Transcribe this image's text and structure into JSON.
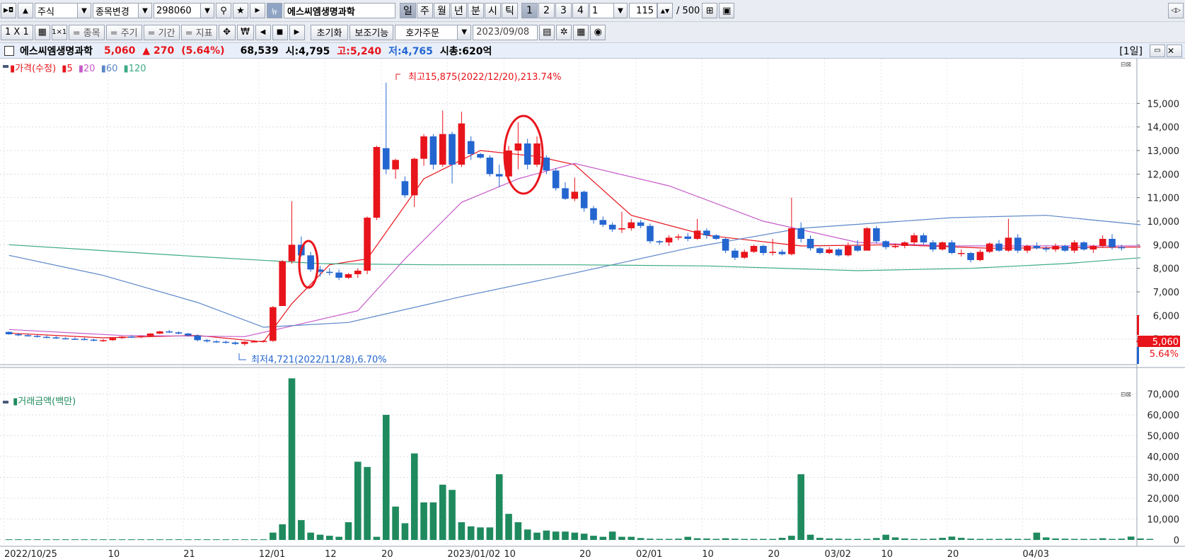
{
  "toolbar": {
    "market": "주식",
    "change_stock": "종목변경",
    "code": "298060",
    "name": "에스씨엠생명과학",
    "periods": [
      "일",
      "주",
      "월",
      "년",
      "분",
      "시",
      "틱"
    ],
    "numbers": [
      "1",
      "2",
      "3",
      "4"
    ],
    "period_value": "1",
    "count": "115",
    "total": "/ 500",
    "layout": "1 X 1",
    "tools": [
      "= 종목",
      "= 주기",
      "= 기간",
      "= 지표"
    ],
    "won": "₩",
    "reset": "초기화",
    "aux": "보조기능",
    "order": "호가주문",
    "date": "2023/09/08"
  },
  "info": {
    "name": "에스씨엠생명과학",
    "price": "5,060",
    "change": "▲ 270",
    "rate": "(5.64%)",
    "volume": "68,539",
    "open": "시:4,795",
    "high": "고:5,240",
    "low": "저:4,765",
    "mcap": "시총:620억",
    "period_tag": "[1일]"
  },
  "legend": {
    "price": "가격(수정)",
    "ma": [
      "5",
      "20",
      "60",
      "120"
    ],
    "volume": "거래금액(백만)"
  },
  "annotations": {
    "high": "최고15,875(2022/12/20),213.74%",
    "low": "최저4,721(2022/11/28),6.70%"
  },
  "price_tag": "5,060",
  "rate_tag": "5.64%",
  "colors": {
    "up": "#e8141b",
    "down": "#2466d0",
    "volume": "#1f8a5e",
    "ma5": "#e8141b",
    "ma20": "#c65ac9",
    "ma60": "#5b86c8",
    "ma120": "#3dab85"
  },
  "chart_data": [
    {
      "type": "candlestick",
      "title": "",
      "ylim": [
        4000,
        16000
      ],
      "y_ticks": [
        "15,000",
        "14,000",
        "13,000",
        "12,000",
        "11,000",
        "10,000",
        "9,000",
        "8,000",
        "7,000",
        "6,000",
        "5,000"
      ],
      "x_tick_labels": [
        "2022/10/25",
        "10",
        "21",
        "12/01",
        "12",
        "20",
        "2023/01/02",
        "10",
        "20",
        "02/01",
        "10",
        "20",
        "03/02",
        "10",
        "20",
        "04/03"
      ],
      "candles": [
        [
          5300,
          5320,
          5180,
          5200
        ],
        [
          5200,
          5260,
          5120,
          5160
        ],
        [
          5160,
          5220,
          5100,
          5130
        ],
        [
          5130,
          5180,
          5060,
          5090
        ],
        [
          5090,
          5150,
          5040,
          5070
        ],
        [
          5070,
          5120,
          5000,
          5030
        ],
        [
          5030,
          5080,
          4980,
          5010
        ],
        [
          5010,
          5070,
          4960,
          5000
        ],
        [
          5000,
          5060,
          4940,
          4970
        ],
        [
          4970,
          5020,
          4900,
          4930
        ],
        [
          4930,
          4990,
          4880,
          4950
        ],
        [
          4950,
          5050,
          4920,
          5040
        ],
        [
          5040,
          5120,
          5000,
          5100
        ],
        [
          5100,
          5160,
          5060,
          5080
        ],
        [
          5080,
          5150,
          5040,
          5120
        ],
        [
          5120,
          5250,
          5100,
          5230
        ],
        [
          5230,
          5350,
          5200,
          5320
        ],
        [
          5320,
          5380,
          5250,
          5280
        ],
        [
          5280,
          5320,
          5200,
          5230
        ],
        [
          5230,
          5260,
          5100,
          5150
        ],
        [
          5150,
          5200,
          4900,
          4950
        ],
        [
          4950,
          5000,
          4850,
          4900
        ],
        [
          4900,
          4950,
          4830,
          4880
        ],
        [
          4880,
          4930,
          4800,
          4850
        ],
        [
          4850,
          4900,
          4750,
          4790
        ],
        [
          4790,
          4900,
          4721,
          4880
        ],
        [
          4880,
          4950,
          4850,
          4900
        ],
        [
          4900,
          4950,
          4860,
          4920
        ],
        [
          4920,
          6400,
          4880,
          6350
        ],
        [
          6400,
          8350,
          7000,
          8300
        ],
        [
          8300,
          10850,
          8200,
          9000
        ],
        [
          9000,
          9350,
          8500,
          8550
        ],
        [
          8550,
          8700,
          7850,
          7950
        ],
        [
          7950,
          8100,
          7650,
          7850
        ],
        [
          7850,
          8000,
          7700,
          7820
        ],
        [
          7820,
          7950,
          7500,
          7600
        ],
        [
          7600,
          7800,
          7550,
          7750
        ],
        [
          7750,
          8000,
          7600,
          7900
        ],
        [
          7900,
          10200,
          7750,
          10150
        ],
        [
          10150,
          13200,
          10050,
          13150
        ],
        [
          13100,
          15875,
          12000,
          12200
        ],
        [
          12200,
          12650,
          11800,
          12600
        ],
        [
          11700,
          11900,
          11000,
          11100
        ],
        [
          11100,
          12700,
          10600,
          12650
        ],
        [
          12650,
          13700,
          12350,
          13600
        ],
        [
          13600,
          13700,
          12200,
          12400
        ],
        [
          12400,
          14700,
          12300,
          13700
        ],
        [
          13700,
          13800,
          11600,
          12400
        ],
        [
          12400,
          14650,
          12300,
          14150
        ],
        [
          13400,
          13600,
          12600,
          12850
        ],
        [
          12850,
          12900,
          12650,
          12700
        ],
        [
          12700,
          12800,
          11900,
          12000
        ],
        [
          12000,
          12400,
          11450,
          11900
        ],
        [
          11900,
          13200,
          11800,
          13000
        ],
        [
          13000,
          14200,
          12200,
          13300
        ],
        [
          13300,
          13500,
          12200,
          12400
        ],
        [
          12400,
          13600,
          12300,
          13300
        ],
        [
          12700,
          12800,
          12000,
          12150
        ],
        [
          12150,
          12250,
          11300,
          11400
        ],
        [
          11400,
          11650,
          10900,
          10950
        ],
        [
          10950,
          11850,
          10850,
          11250
        ],
        [
          11250,
          11300,
          10400,
          10550
        ],
        [
          10550,
          10650,
          9900,
          10050
        ],
        [
          10050,
          10200,
          9750,
          9850
        ],
        [
          9850,
          9950,
          9550,
          9650
        ],
        [
          9650,
          10400,
          9500,
          9700
        ],
        [
          9700,
          10100,
          9600,
          9950
        ],
        [
          9950,
          10050,
          9700,
          9800
        ],
        [
          9800,
          9900,
          9050,
          9150
        ],
        [
          9150,
          9200,
          9000,
          9100
        ],
        [
          9100,
          9400,
          8950,
          9300
        ],
        [
          9300,
          9450,
          9200,
          9350
        ],
        [
          9350,
          9500,
          9150,
          9250
        ],
        [
          9250,
          10100,
          9200,
          9600
        ],
        [
          9600,
          9700,
          9250,
          9400
        ],
        [
          9400,
          9450,
          9200,
          9250
        ],
        [
          9250,
          9300,
          8650,
          8750
        ],
        [
          8750,
          8850,
          8350,
          8450
        ],
        [
          8450,
          8800,
          8400,
          8700
        ],
        [
          8700,
          9000,
          8650,
          8950
        ],
        [
          8950,
          9000,
          8550,
          8650
        ],
        [
          8650,
          9250,
          8550,
          8700
        ],
        [
          8700,
          8800,
          8550,
          8600
        ],
        [
          8600,
          11000,
          8550,
          9700
        ],
        [
          9700,
          9950,
          9100,
          9250
        ],
        [
          9250,
          9400,
          8750,
          8850
        ],
        [
          8850,
          8900,
          8600,
          8650
        ],
        [
          8650,
          8900,
          8600,
          8800
        ],
        [
          8800,
          8850,
          8500,
          8550
        ],
        [
          8550,
          9100,
          8500,
          8950
        ],
        [
          8950,
          9200,
          8700,
          8750
        ],
        [
          8750,
          9750,
          8900,
          9700
        ],
        [
          9700,
          9800,
          9050,
          9150
        ],
        [
          9150,
          9200,
          8800,
          8900
        ],
        [
          8900,
          9050,
          8850,
          8950
        ],
        [
          8950,
          9150,
          8850,
          9100
        ],
        [
          9100,
          9500,
          8950,
          9400
        ],
        [
          9400,
          9500,
          9000,
          9100
        ],
        [
          9100,
          9200,
          8700,
          8800
        ],
        [
          8800,
          9150,
          8750,
          9100
        ],
        [
          9100,
          9200,
          8600,
          8650
        ],
        [
          8650,
          8800,
          8500,
          8650
        ],
        [
          8650,
          8700,
          8250,
          8350
        ],
        [
          8350,
          8800,
          8300,
          8700
        ],
        [
          8700,
          9100,
          8650,
          9050
        ],
        [
          9050,
          9200,
          8700,
          8750
        ],
        [
          8750,
          10100,
          8700,
          9300
        ],
        [
          9300,
          9450,
          8650,
          8750
        ],
        [
          8750,
          9000,
          8650,
          8950
        ],
        [
          8950,
          9100,
          8800,
          8850
        ],
        [
          8850,
          8950,
          8700,
          8800
        ],
        [
          8800,
          9050,
          8700,
          8950
        ],
        [
          8950,
          9000,
          8700,
          8750
        ],
        [
          8750,
          9200,
          8650,
          9100
        ],
        [
          9100,
          9150,
          8750,
          8800
        ],
        [
          8800,
          9000,
          8650,
          8950
        ],
        [
          8950,
          9400,
          8900,
          9250
        ],
        [
          9250,
          9450,
          8800,
          8900
        ],
        [
          8900,
          9000,
          8750,
          8850
        ]
      ],
      "ma": {
        "5": [
          [
            0,
            5250
          ],
          [
            10,
            5050
          ],
          [
            20,
            5150
          ],
          [
            27,
            4880
          ],
          [
            30,
            6500
          ],
          [
            34,
            8150
          ],
          [
            38,
            8400
          ],
          [
            44,
            11800
          ],
          [
            50,
            13000
          ],
          [
            56,
            12750
          ],
          [
            60,
            12400
          ],
          [
            66,
            10250
          ],
          [
            74,
            9400
          ],
          [
            84,
            8950
          ],
          [
            94,
            9000
          ],
          [
            104,
            8850
          ],
          [
            120,
            8900
          ]
        ],
        "20": [
          [
            0,
            5400
          ],
          [
            12,
            5150
          ],
          [
            25,
            5100
          ],
          [
            30,
            5550
          ],
          [
            37,
            6200
          ],
          [
            42,
            8400
          ],
          [
            48,
            10800
          ],
          [
            54,
            11800
          ],
          [
            60,
            12450
          ],
          [
            70,
            11500
          ],
          [
            80,
            10000
          ],
          [
            90,
            9100
          ],
          [
            100,
            8950
          ],
          [
            110,
            8950
          ],
          [
            120,
            8950
          ]
        ],
        "60": [
          [
            0,
            8550
          ],
          [
            10,
            7700
          ],
          [
            20,
            6550
          ],
          [
            27,
            5500
          ],
          [
            36,
            5700
          ],
          [
            48,
            6800
          ],
          [
            60,
            7800
          ],
          [
            72,
            8850
          ],
          [
            84,
            9700
          ],
          [
            100,
            10150
          ],
          [
            110,
            10250
          ],
          [
            120,
            9850
          ]
        ],
        "120": [
          [
            0,
            9000
          ],
          [
            20,
            8500
          ],
          [
            33,
            8200
          ],
          [
            45,
            8150
          ],
          [
            60,
            8150
          ],
          [
            74,
            8100
          ],
          [
            90,
            7900
          ],
          [
            102,
            8000
          ],
          [
            112,
            8200
          ],
          [
            120,
            8450
          ]
        ]
      }
    },
    {
      "type": "bar",
      "title": "거래금액(백만)",
      "ylim": [
        0,
        80000
      ],
      "y_ticks": [
        "70,000",
        "60,000",
        "50,000",
        "40,000",
        "30,000",
        "20,000",
        "10,000",
        "0"
      ],
      "values": [
        300,
        300,
        300,
        300,
        300,
        300,
        300,
        300,
        300,
        300,
        300,
        300,
        300,
        300,
        300,
        300,
        300,
        300,
        300,
        300,
        300,
        300,
        300,
        300,
        300,
        300,
        300,
        300,
        3500,
        7500,
        77500,
        9500,
        3500,
        2500,
        2000,
        1500,
        8500,
        37500,
        35000,
        1500,
        60000,
        16000,
        8000,
        41500,
        18000,
        18000,
        26500,
        24000,
        8500,
        6500,
        6000,
        6000,
        31500,
        12500,
        8500,
        5000,
        3500,
        4500,
        4000,
        4000,
        3500,
        3000,
        2000,
        1500,
        4000,
        1500,
        1500,
        900,
        600,
        500,
        500,
        600,
        1500,
        800,
        700,
        500,
        800,
        600,
        500,
        500,
        500,
        500,
        1000,
        2000,
        31500,
        2500,
        1000,
        700,
        600,
        500,
        500,
        500,
        900,
        2500,
        1200,
        700,
        500,
        500,
        600,
        1000,
        1600,
        1000,
        600,
        500,
        500,
        500,
        600,
        500,
        500,
        3500,
        1200,
        700,
        600,
        500,
        500,
        500,
        800,
        500,
        600,
        1600,
        700,
        500
      ]
    }
  ]
}
